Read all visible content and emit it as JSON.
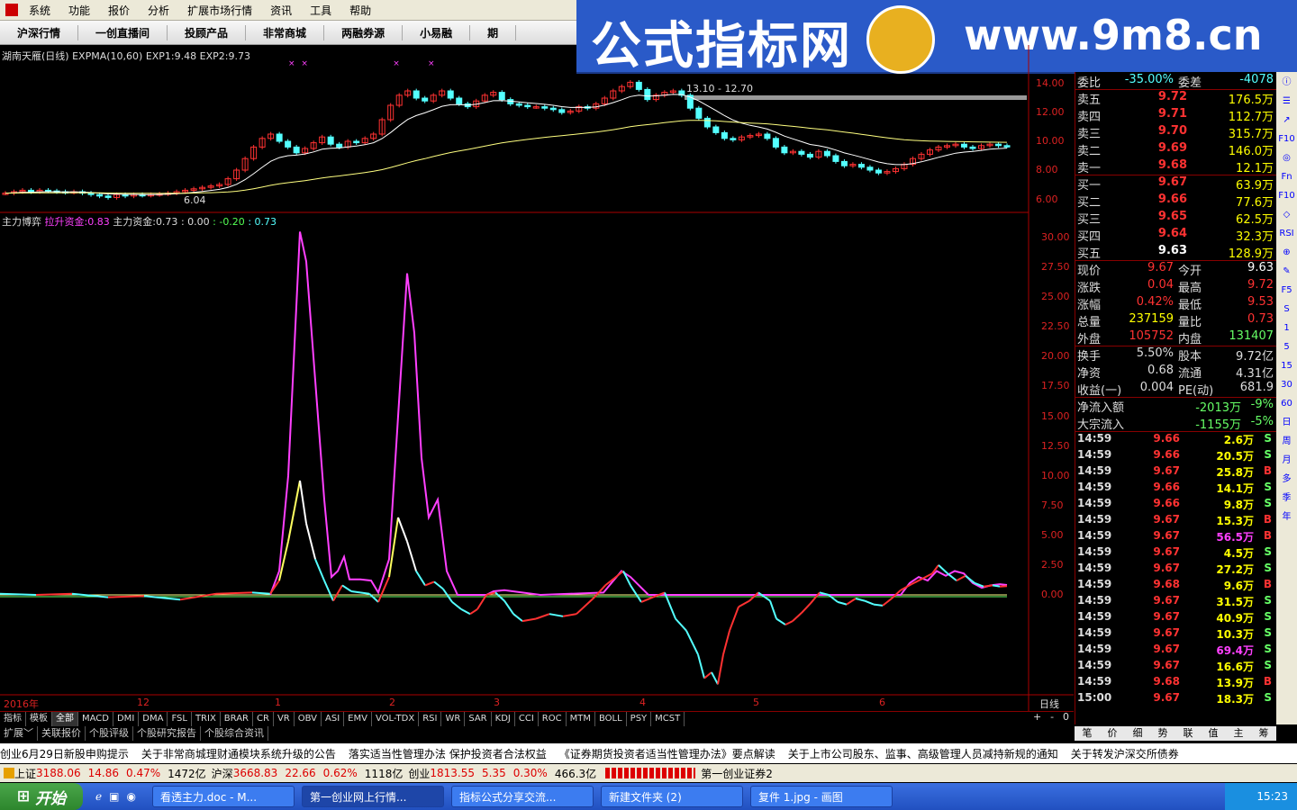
{
  "menu": [
    "系统",
    "功能",
    "报价",
    "分析",
    "扩展市场行情",
    "资讯",
    "工具",
    "帮助"
  ],
  "toolbar": [
    "沪深行情",
    "一创直播间",
    "投顾产品",
    "非常商城",
    "两融券源",
    "小易融",
    "期"
  ],
  "banner": {
    "title": "公式指标网",
    "url": "www.9m8.cn"
  },
  "main_chart": {
    "title": "湖南天雁(日线)",
    "indicator": "EXPMA(10,60)",
    "exp1_label": "EXP1:",
    "exp1": "9.48",
    "exp2_label": "EXP2:",
    "exp2": "9.73",
    "high_label": "13.10 - 12.70",
    "low_label": "6.04",
    "y_ticks": [
      "14.00",
      "12.00",
      "10.00",
      "8.00",
      "6.00"
    ]
  },
  "sub_chart": {
    "name": "主力博弈",
    "l1": "拉升资金:",
    "v1": "0.83",
    "l2": "主力资金:",
    "v2": "0.73",
    "v3": ": 0.00",
    "v4": ": -0.20",
    "v5": ": 0.73",
    "y_ticks": [
      "30.00",
      "27.50",
      "25.00",
      "22.50",
      "20.00",
      "17.50",
      "15.00",
      "12.50",
      "10.00",
      "7.50",
      "5.00",
      "2.50",
      "0.00"
    ]
  },
  "x_axis": {
    "labels": [
      "2016年",
      "12",
      "1",
      "2",
      "3",
      "4",
      "5",
      "6"
    ],
    "period": "日线"
  },
  "indicator_tabs": [
    "指标",
    "模板",
    "全部",
    "MACD",
    "DMI",
    "DMA",
    "FSL",
    "TRIX",
    "BRAR",
    "CR",
    "VR",
    "OBV",
    "ASI",
    "EMV",
    "VOL-TDX",
    "RSI",
    "WR",
    "SAR",
    "KDJ",
    "CCI",
    "ROC",
    "MTM",
    "BOLL",
    "PSY",
    "MCST"
  ],
  "indicator_tab_controls": [
    "+",
    "-",
    "0"
  ],
  "info_tabs": [
    "扩展﹀",
    "关联报价",
    "个股评级",
    "个股研究报告",
    "个股综合资讯"
  ],
  "quote": {
    "weibi": {
      "l": "委比",
      "v": "-35.00%",
      "l2": "委差",
      "v2": "-4078"
    },
    "asks": [
      {
        "l": "卖五",
        "p": "9.72",
        "v": "176.5万"
      },
      {
        "l": "卖四",
        "p": "9.71",
        "v": "112.7万"
      },
      {
        "l": "卖三",
        "p": "9.70",
        "v": "315.7万"
      },
      {
        "l": "卖二",
        "p": "9.69",
        "v": "146.0万"
      },
      {
        "l": "卖一",
        "p": "9.68",
        "v": "12.1万"
      }
    ],
    "bids": [
      {
        "l": "买一",
        "p": "9.67",
        "v": "63.9万"
      },
      {
        "l": "买二",
        "p": "9.66",
        "v": "77.6万"
      },
      {
        "l": "买三",
        "p": "9.65",
        "v": "62.5万"
      },
      {
        "l": "买四",
        "p": "9.64",
        "v": "32.3万"
      },
      {
        "l": "买五",
        "p": "9.63",
        "v": "128.9万"
      }
    ],
    "stats": [
      {
        "l": "现价",
        "v": "9.67",
        "l2": "今开",
        "v2": "9.63"
      },
      {
        "l": "涨跌",
        "v": "0.04",
        "l2": "最高",
        "v2": "9.72"
      },
      {
        "l": "涨幅",
        "v": "0.42%",
        "l2": "最低",
        "v2": "9.53"
      },
      {
        "l": "总量",
        "v": "237159",
        "l2": "量比",
        "v2": "0.73"
      },
      {
        "l": "外盘",
        "v": "105752",
        "l2": "内盘",
        "v2": "131407"
      }
    ],
    "stats2": [
      {
        "l": "换手",
        "v": "5.50%",
        "l2": "股本",
        "v2": "9.72亿"
      },
      {
        "l": "净资",
        "v": "0.68",
        "l2": "流通",
        "v2": "4.31亿"
      },
      {
        "l": "收益(一)",
        "v": "0.004",
        "l2": "PE(动)",
        "v2": "681.9"
      }
    ],
    "flows": [
      {
        "l": "净流入额",
        "v": "-2013万",
        "p": "-9%"
      },
      {
        "l": "大宗流入",
        "v": "-1155万",
        "p": "-5%"
      }
    ],
    "ticks": [
      {
        "t": "14:59",
        "p": "9.66",
        "v": "2.6万",
        "s": "S"
      },
      {
        "t": "14:59",
        "p": "9.66",
        "v": "20.5万",
        "s": "S"
      },
      {
        "t": "14:59",
        "p": "9.67",
        "v": "25.8万",
        "s": "B"
      },
      {
        "t": "14:59",
        "p": "9.66",
        "v": "14.1万",
        "s": "S"
      },
      {
        "t": "14:59",
        "p": "9.66",
        "v": "9.8万",
        "s": "S"
      },
      {
        "t": "14:59",
        "p": "9.67",
        "v": "15.3万",
        "s": "B"
      },
      {
        "t": "14:59",
        "p": "9.67",
        "v": "56.5万",
        "s": "B"
      },
      {
        "t": "14:59",
        "p": "9.67",
        "v": "4.5万",
        "s": "S"
      },
      {
        "t": "14:59",
        "p": "9.67",
        "v": "27.2万",
        "s": "S"
      },
      {
        "t": "14:59",
        "p": "9.68",
        "v": "9.6万",
        "s": "B"
      },
      {
        "t": "14:59",
        "p": "9.67",
        "v": "31.5万",
        "s": "S"
      },
      {
        "t": "14:59",
        "p": "9.67",
        "v": "40.9万",
        "s": "S"
      },
      {
        "t": "14:59",
        "p": "9.67",
        "v": "10.3万",
        "s": "S"
      },
      {
        "t": "14:59",
        "p": "9.67",
        "v": "69.4万",
        "s": "S"
      },
      {
        "t": "14:59",
        "p": "9.67",
        "v": "16.6万",
        "s": "S"
      },
      {
        "t": "14:59",
        "p": "9.68",
        "v": "13.9万",
        "s": "B"
      },
      {
        "t": "15:00",
        "p": "9.67",
        "v": "18.3万",
        "s": "S"
      }
    ]
  },
  "right_tabs": [
    "笔",
    "价",
    "细",
    "势",
    "联",
    "值",
    "主",
    "筹"
  ],
  "right_tool": [
    "ⓘ",
    "☰",
    "↗",
    "F10",
    "◎",
    "Fn",
    "F10",
    "◇",
    "RSI",
    "⊕",
    "✎",
    "F5",
    "S",
    "1",
    "5",
    "15",
    "30",
    "60",
    "日",
    "周",
    "月",
    "多",
    "季",
    "年"
  ],
  "news": [
    "创业6月29日新股申购提示",
    "关于非常商城理财通模块系统升级的公告",
    "落实适当性管理办法 保护投资者合法权益",
    "《证券期货投资者适当性管理办法》要点解读",
    "关于上市公司股东、监事、高级管理人员减持新规的通知",
    "关于转发沪深交所债券"
  ],
  "status": {
    "sh_l": "上证",
    "sh": "3188.06",
    "sh_c": "14.86",
    "sh_p": "0.47%",
    "sh_a": "1472亿",
    "hs_l": "沪深",
    "hs": "3668.83",
    "hs_c": "22.66",
    "hs_p": "0.62%",
    "hs_a": "1118亿",
    "cy_l": "创业",
    "cy": "1813.55",
    "cy_c": "5.35",
    "cy_p": "0.30%",
    "cy_a": "466.3亿",
    "server": "第一创业证券2"
  },
  "taskbar": {
    "start": "开始",
    "tasks": [
      "看透主力.doc - M...",
      "第一创业网上行情...",
      "指标公式分享交流...",
      "新建文件夹 (2)",
      "复件 1.jpg - 画图"
    ],
    "clock": "15:23"
  },
  "colors": {
    "up": "#ff3232",
    "down": "#54ffff",
    "ma1": "#ffffff",
    "ma2": "#ffff80",
    "magenta": "#ff40ff"
  }
}
